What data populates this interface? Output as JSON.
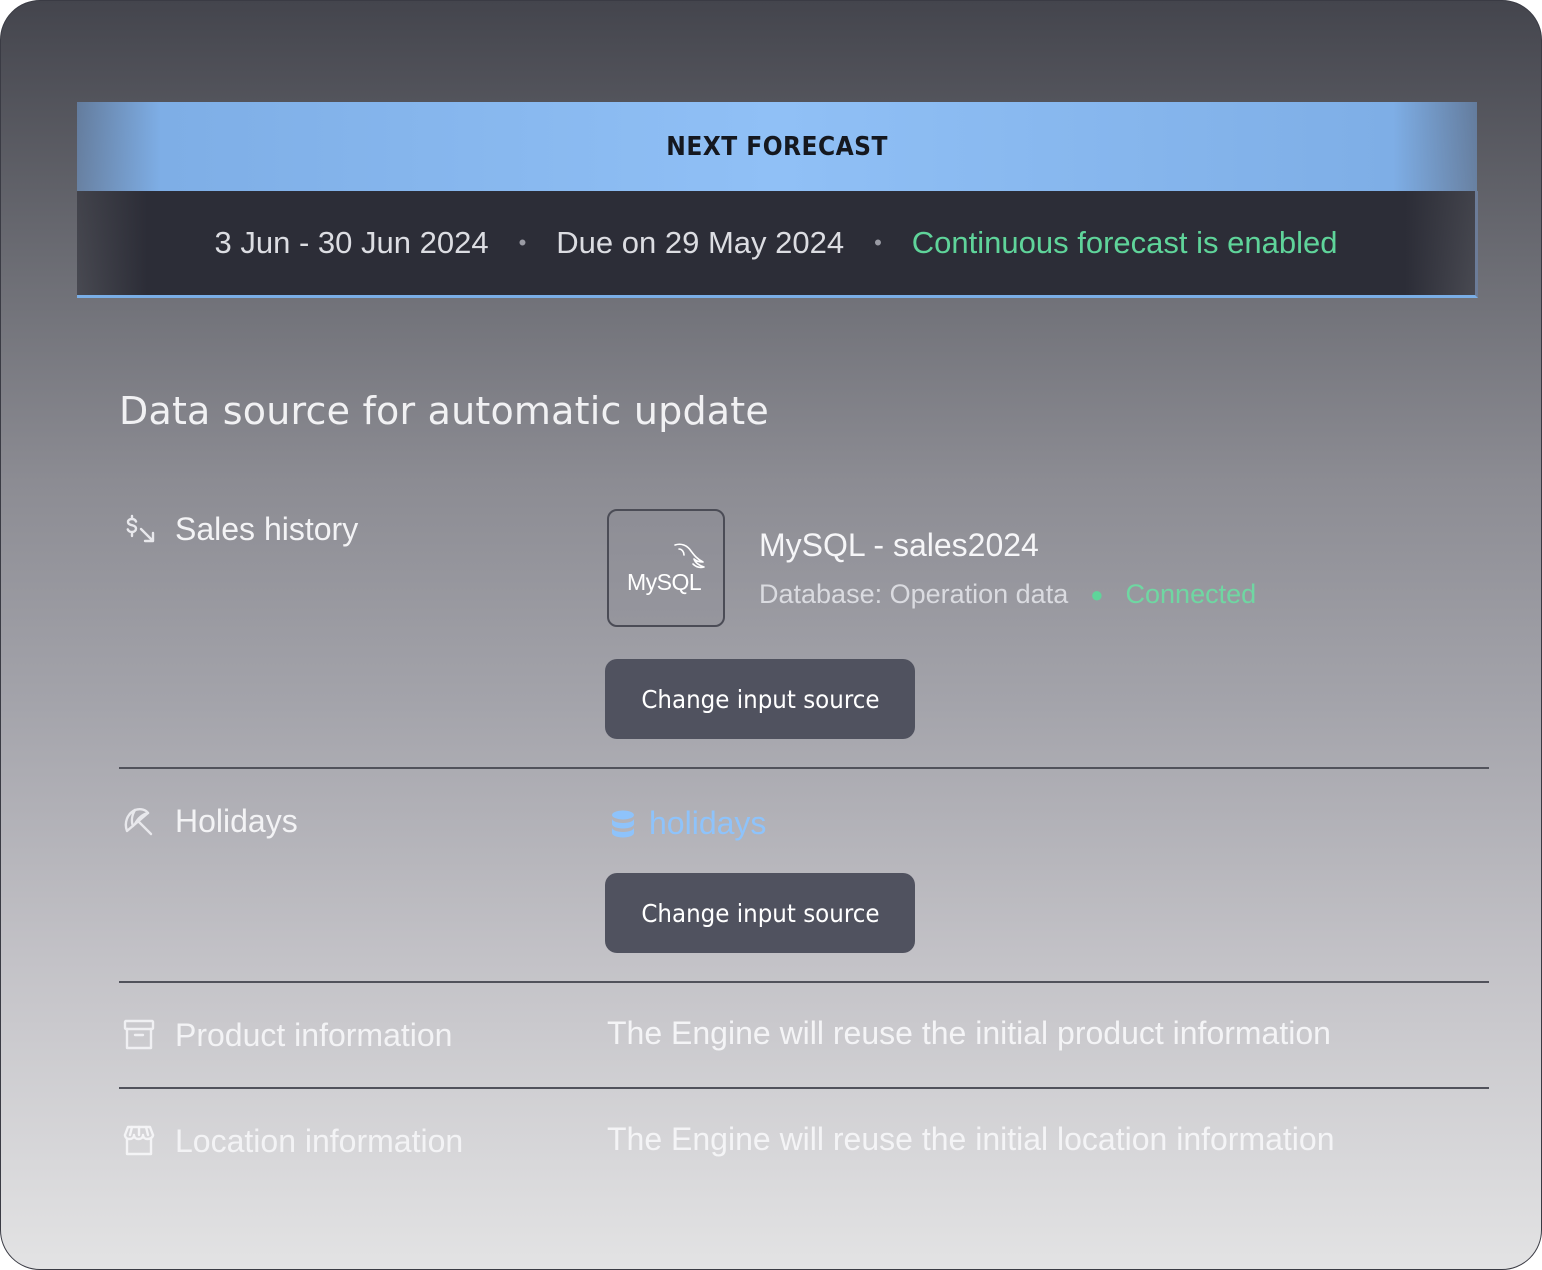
{
  "banner": {
    "title": "NEXT FORECAST",
    "date_range": "3 Jun - 30 Jun 2024",
    "due": "Due on 29 May 2024",
    "status": "Continuous forecast is enabled",
    "separator": "•"
  },
  "section": {
    "title": "Data source for automatic update"
  },
  "rows": {
    "sales_history": {
      "label": "Sales history",
      "icon": "currency-exchange-icon",
      "logo_text": "MySQL",
      "source_name": "MySQL - sales2024",
      "database": "Database: Operation data",
      "status": "Connected",
      "status_color": "#5fd49a",
      "button": "Change input source"
    },
    "holidays": {
      "label": "Holidays",
      "icon": "beach-umbrella-icon",
      "source_name": "holidays",
      "source_icon": "database-icon",
      "link_color": "#8ec3fb",
      "button": "Change input source"
    },
    "product_information": {
      "label": "Product information",
      "icon": "archive-box-icon",
      "text": "The Engine will reuse the initial product information"
    },
    "location_information": {
      "label": "Location information",
      "icon": "storefront-icon",
      "text": "The Engine will reuse the initial location information"
    }
  }
}
